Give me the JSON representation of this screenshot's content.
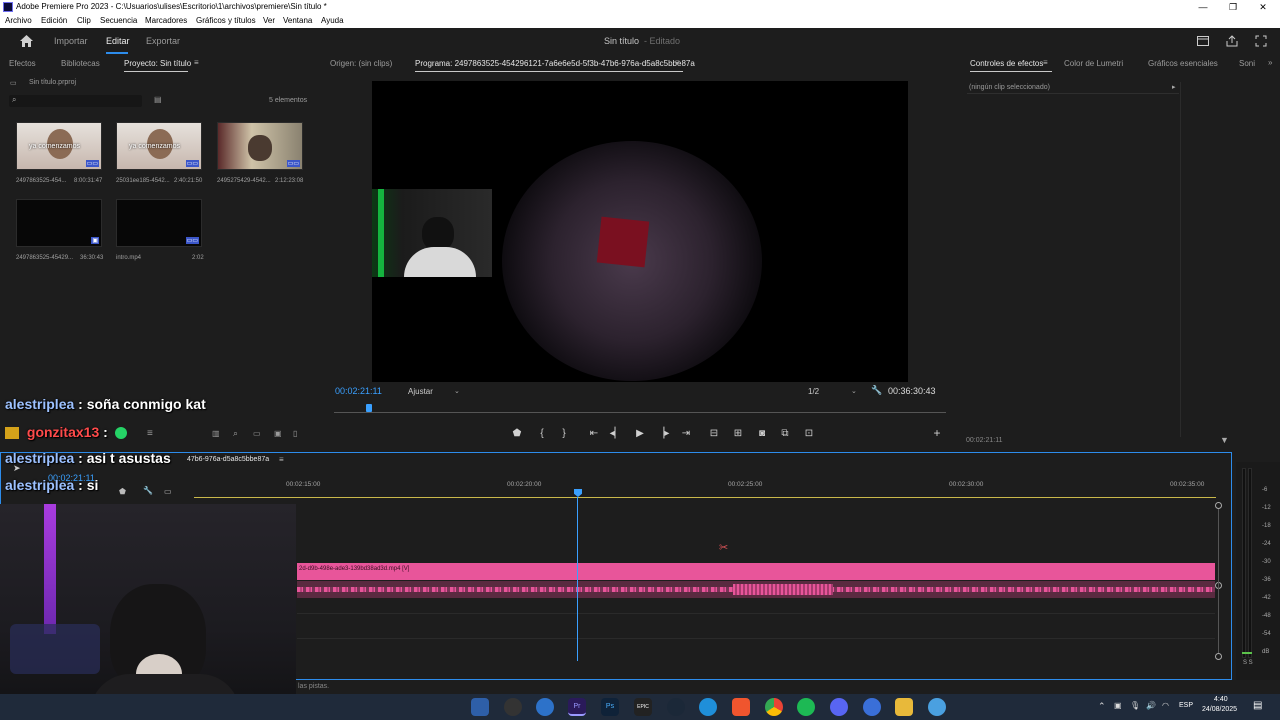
{
  "window": {
    "title": "Adobe Premiere Pro 2023 - C:\\Usuarios\\ulises\\Escritorio\\1\\archivos\\premiere\\Sin título *",
    "min": "—",
    "max": "❐",
    "close": "✕"
  },
  "menu": [
    "Archivo",
    "Edición",
    "Clip",
    "Secuencia",
    "Marcadores",
    "Gráficos y títulos",
    "Ver",
    "Ventana",
    "Ayuda"
  ],
  "header": {
    "home_icon": "home-icon",
    "nav": [
      "Importar",
      "Editar",
      "Exportar"
    ],
    "project_title": "Sin título",
    "project_state": "- Editado"
  },
  "project_panel": {
    "tabs": [
      "Efectos",
      "Bibliotecas",
      "Proyecto: Sin título"
    ],
    "file": "Sin título.prproj",
    "count": "5 elementos",
    "items": [
      {
        "name": "24978635​25-454...",
        "duration": "8:00:31:47",
        "overlay": "ya comenzamos"
      },
      {
        "name": "25031ee185-4542...",
        "duration": "2:40:21:50",
        "overlay": "ya comenzamos"
      },
      {
        "name": "24952754​29-4542...",
        "duration": "2:12:23:08",
        "overlay": ""
      },
      {
        "name": "24978635​25-45429...",
        "duration": "36:30:43",
        "overlay": ""
      },
      {
        "name": "intro.mp4",
        "duration": "2:02",
        "overlay": ""
      }
    ]
  },
  "monitor": {
    "source_tab": "Origen: (sin clips)",
    "program_tab": "Programa: 2497863525-454296121-7a6e6e5d-5f3b-47b6-976a-d5a8c5bbe87a",
    "timecode": "00:02:21:11",
    "fit": "Ajustar",
    "resolution": "1/2",
    "duration": "00:36:30:43"
  },
  "effects_panel": {
    "tabs": [
      "Controles de efectos",
      "Color de Lumetri",
      "Gráficos esenciales",
      "Soni"
    ],
    "no_clip": "(ningún clip seleccionado)",
    "timecode": "00:02:21:11"
  },
  "timeline": {
    "sequence": "47b6-976a-d5a8c5bbe87a",
    "timecode": "00:02:21:11",
    "ruler": [
      "00:02:15:00",
      "00:02:20:00",
      "00:02:25:00",
      "00:02:30:00",
      "00:02:35:00"
    ],
    "clip_label": "2d-d9b-498e-ade3-139bd38ad3d.mp4 [V]",
    "status": "las pistas.",
    "db_scale": [
      "-6",
      "-12",
      "-18",
      "-24",
      "-30",
      "-36",
      "-42",
      "-48",
      "-54",
      "dB"
    ],
    "meter_foot": "S S"
  },
  "chat": [
    {
      "user": "alestriplea",
      "text": ": soña conmigo kat"
    },
    {
      "user": "gonzitax13",
      "text": ":"
    },
    {
      "user": "alestriplea",
      "text": ": asi t asustas"
    },
    {
      "user": "alestriplea",
      "text": ": si"
    }
  ],
  "taskbar": {
    "apps": [
      "Pr",
      "Ps",
      "EPIC"
    ],
    "lang": "ESP",
    "time": "4:40",
    "date": "24/08/2025"
  },
  "colors": {
    "accent_blue": "#2d8ceb",
    "clip_pink": "#e8559a",
    "timecode_blue": "#3aa0ff",
    "title_bg": "#ffffff"
  }
}
